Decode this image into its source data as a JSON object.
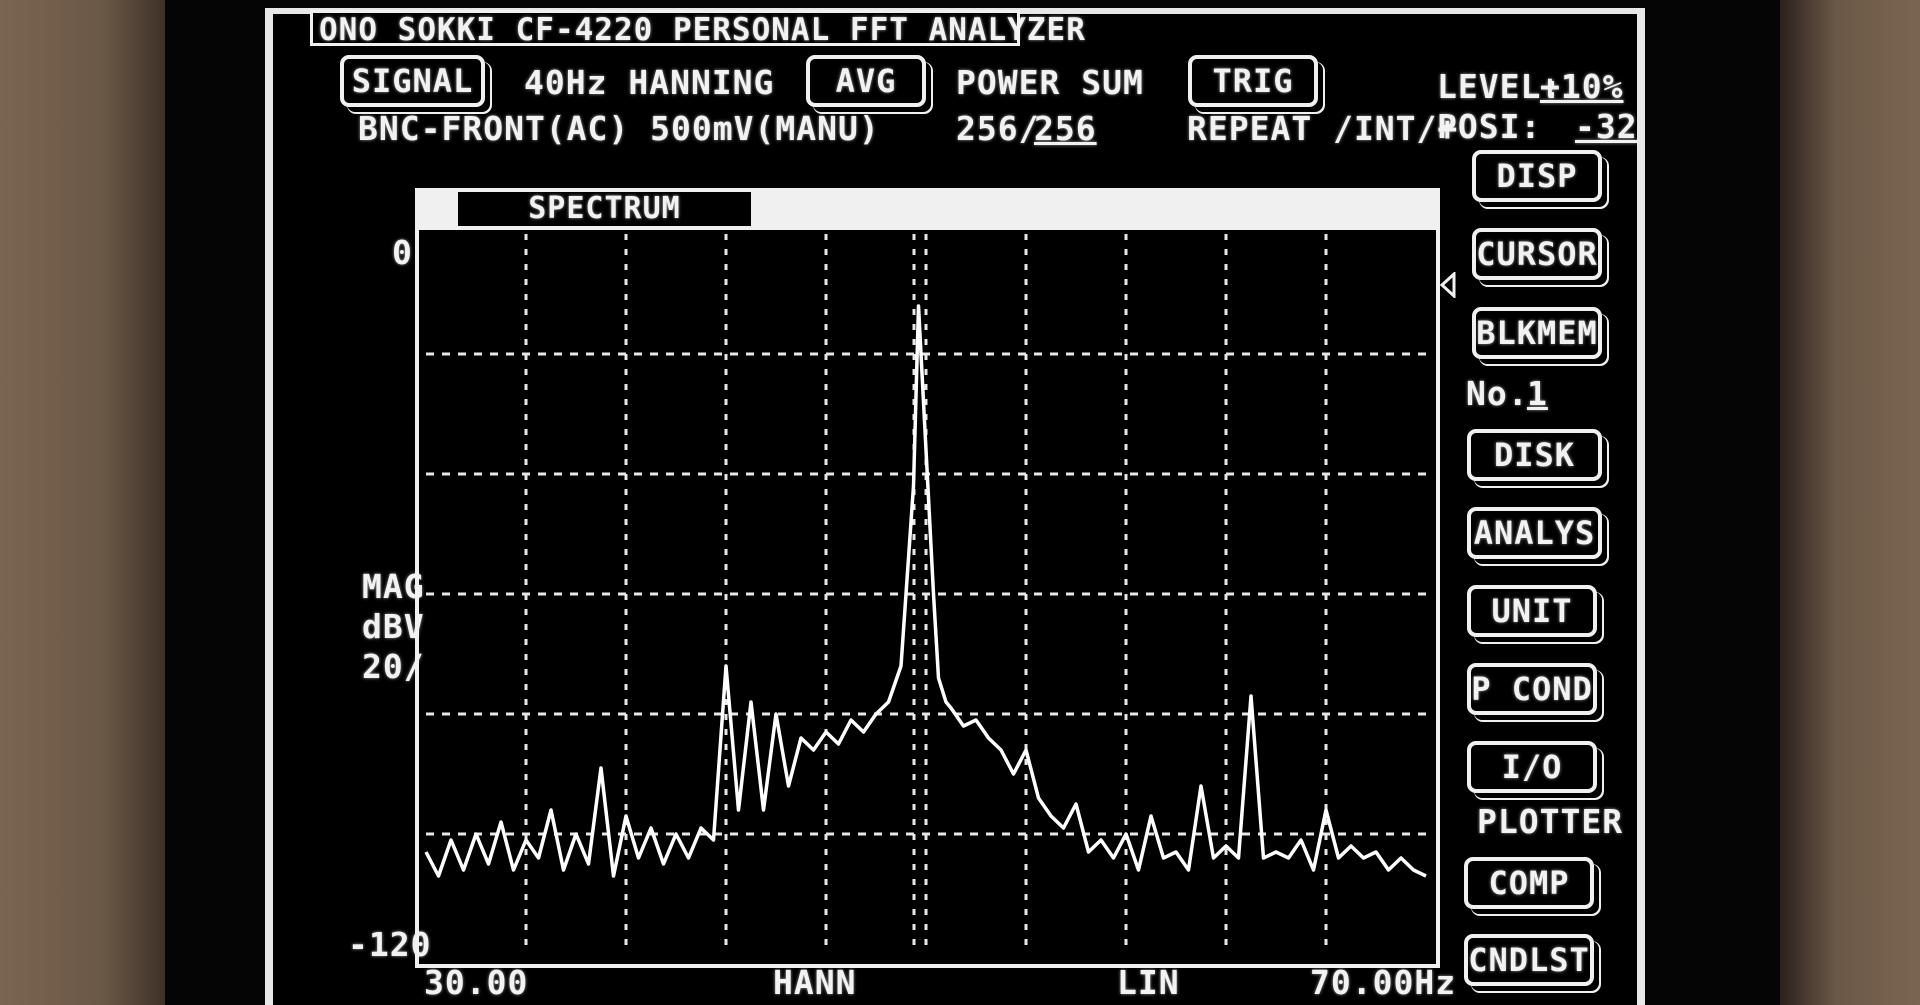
{
  "title": "ONO SOKKI CF-4220 PERSONAL FFT ANALYZER",
  "signal": {
    "button_label": "SIGNAL",
    "range_window": "40Hz HANNING",
    "input": "BNC-FRONT(AC) 500mV(MANU)"
  },
  "avg": {
    "button_label": "AVG",
    "mode": "POWER SUM",
    "count_current": "256/",
    "count_target": "256"
  },
  "trig": {
    "button_label": "TRIG",
    "mode": "REPEAT /INT/+"
  },
  "level": {
    "label": "LEVEL:",
    "value": "+10%"
  },
  "posi": {
    "label": "POSI:",
    "value": "-32"
  },
  "side_menu": {
    "disp": "DISP",
    "cursor": "CURSOR",
    "blkmem": "BLKMEM",
    "no_label": "No.",
    "no_value": "1",
    "disk": "DISK",
    "analys": "ANALYS",
    "unit": "UNIT",
    "p_cond": "P COND",
    "io": "I/O",
    "plotter": "PLOTTER",
    "comp": "COMP",
    "cndlst": "CNDLST"
  },
  "spectrum": {
    "label": "SPECTRUM",
    "y_top": "0",
    "y_bottom": "-120",
    "y_unit_1": "MAG",
    "y_unit_2": "dBV",
    "y_unit_3": "20/",
    "x_start": "30.00",
    "x_window": "HANN",
    "x_scale": "LIN",
    "x_end": "70.00Hz"
  },
  "chart_data": {
    "type": "line",
    "title": "SPECTRUM",
    "xlabel": "",
    "ylabel": "MAG dBV",
    "xlim": [
      30,
      70
    ],
    "ylim": [
      -120,
      0
    ],
    "grid": true,
    "series": [
      {
        "x": [
          30,
          30.5,
          31,
          31.5,
          32,
          32.5,
          33,
          33.5,
          34,
          34.5,
          35,
          35.5,
          36,
          36.5,
          37,
          37.5,
          38,
          38.5,
          39,
          39.5,
          40,
          40.5,
          41,
          41.5,
          42,
          42.5,
          43,
          43.5,
          44,
          44.5,
          45,
          45.5,
          46,
          46.5,
          47,
          47.5,
          48,
          48.5,
          49,
          49.2,
          49.5,
          49.7,
          50,
          50.3,
          50.5,
          50.8,
          51,
          51.5,
          52,
          52.5,
          53,
          53.5,
          54,
          54.5,
          55,
          55.5,
          56,
          56.5,
          57,
          57.5,
          58,
          58.5,
          59,
          59.5,
          60,
          60.5,
          61,
          61.5,
          62,
          62.5,
          63,
          63.5,
          64,
          64.5,
          65,
          65.5,
          66,
          66.5,
          67,
          67.5,
          68,
          68.5,
          69,
          69.5,
          70
        ],
        "y": [
          -103,
          -107,
          -101,
          -106,
          -100,
          -105,
          -98,
          -106,
          -101,
          -104,
          -96,
          -106,
          -100,
          -105,
          -89,
          -107,
          -97,
          -104,
          -99,
          -105,
          -100,
          -104,
          -99,
          -101,
          -72,
          -96,
          -78,
          -96,
          -80,
          -92,
          -84,
          -86,
          -83,
          -85,
          -81,
          -83,
          -80,
          -78,
          -72,
          -60,
          -42,
          -12,
          -36,
          -60,
          -74,
          -78,
          -79,
          -82,
          -81,
          -84,
          -86,
          -90,
          -86,
          -94,
          -97,
          -99,
          -95,
          -103,
          -101,
          -104,
          -100,
          -106,
          -97,
          -104,
          -103,
          -106,
          -92,
          -104,
          -102,
          -104,
          -77,
          -104,
          -103,
          -104,
          -101,
          -106,
          -96,
          -104,
          -102,
          -104,
          -103,
          -106,
          -104,
          -106,
          -107
        ]
      }
    ]
  }
}
